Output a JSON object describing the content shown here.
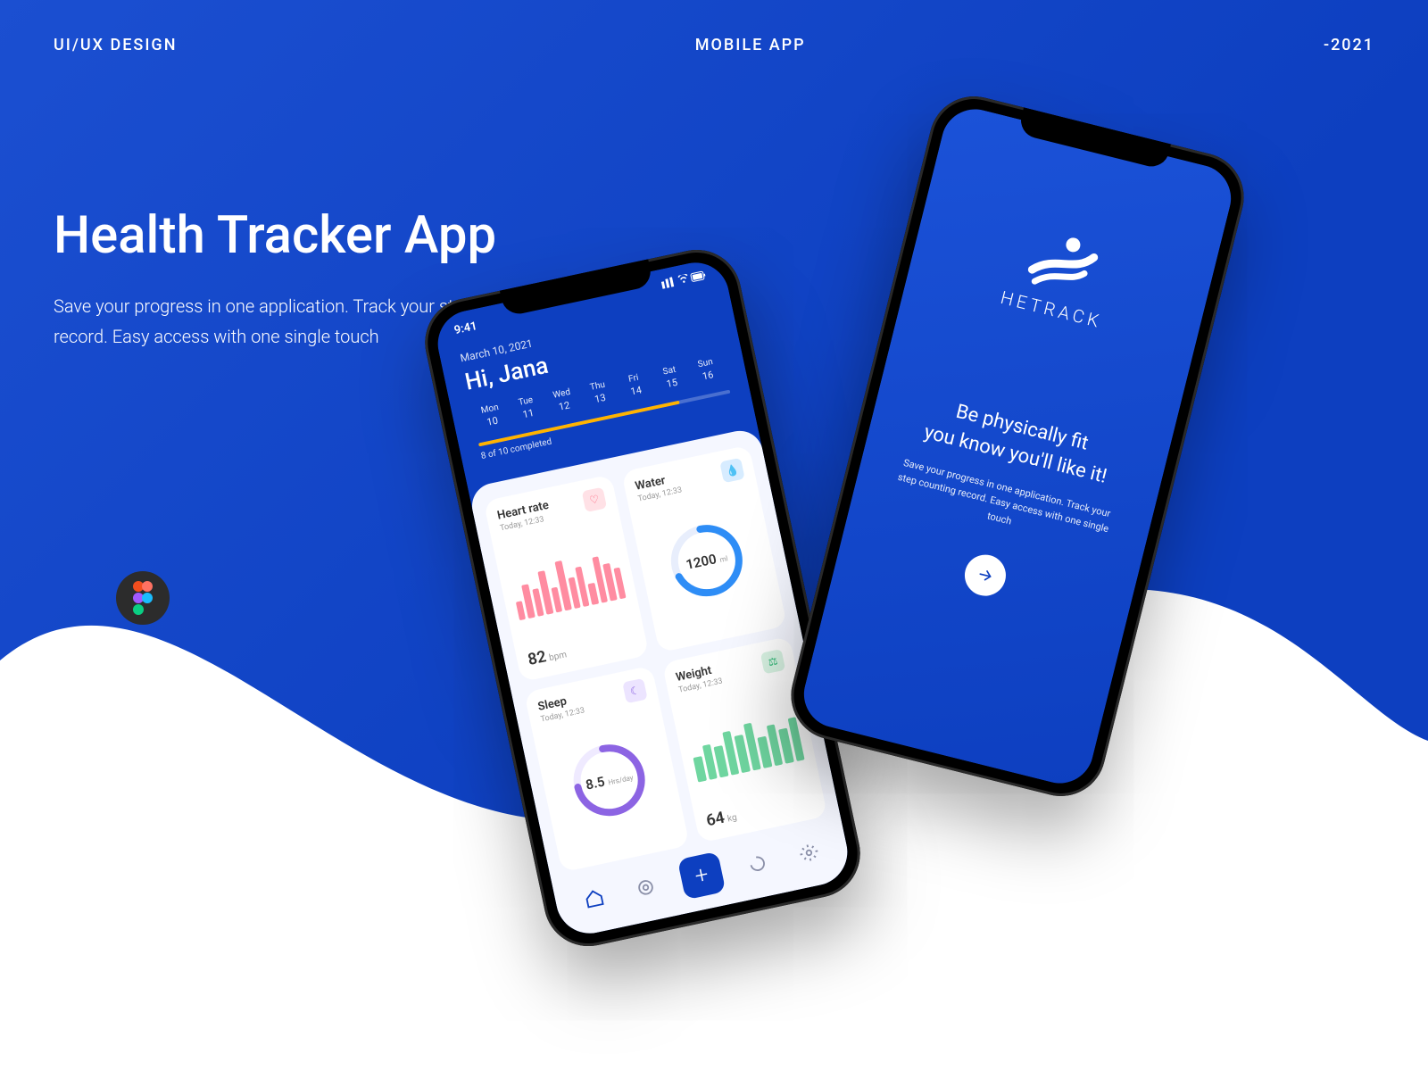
{
  "header": {
    "left": "UI/UX DESIGN",
    "center": "MOBILE APP",
    "right": "-2021"
  },
  "hero": {
    "title": "Health Tracker App",
    "subtitle": "Save your progress in one application. Track your step counting record. Easy access with one single touch"
  },
  "dashboard": {
    "status_time": "9:41",
    "date": "March 10, 2021",
    "greeting": "Hi, Jana",
    "week": [
      {
        "d": "Mon",
        "n": "10"
      },
      {
        "d": "Tue",
        "n": "11"
      },
      {
        "d": "Wed",
        "n": "12"
      },
      {
        "d": "Thu",
        "n": "13"
      },
      {
        "d": "Fri",
        "n": "14"
      },
      {
        "d": "Sat",
        "n": "15"
      },
      {
        "d": "Sun",
        "n": "16"
      }
    ],
    "completed": "8 of 10 completed",
    "cards": {
      "heart": {
        "title": "Heart rate",
        "time": "Today, 12:33",
        "value": "82",
        "unit": "bpm",
        "bars": [
          30,
          55,
          45,
          70,
          40,
          80,
          50,
          65,
          35,
          75,
          60,
          50
        ]
      },
      "water": {
        "title": "Water",
        "time": "Today, 12:33",
        "value": "1200",
        "unit": "ml",
        "percent": 70
      },
      "sleep": {
        "title": "Sleep",
        "time": "Today, 12:33",
        "value": "8.5",
        "unit": "Hrs/day",
        "percent": 75
      },
      "weight": {
        "title": "Weight",
        "time": "Today, 12:33",
        "value": "64",
        "unit": "kg",
        "bars": [
          40,
          55,
          50,
          70,
          60,
          75,
          50,
          65,
          55,
          70
        ]
      }
    }
  },
  "splash": {
    "brand": "HETRACK",
    "headline_l1": "Be physically fit",
    "headline_l2": "you know you'll like it!",
    "body": "Save your progress in one application. Track your step counting record. Easy access with one single touch"
  }
}
